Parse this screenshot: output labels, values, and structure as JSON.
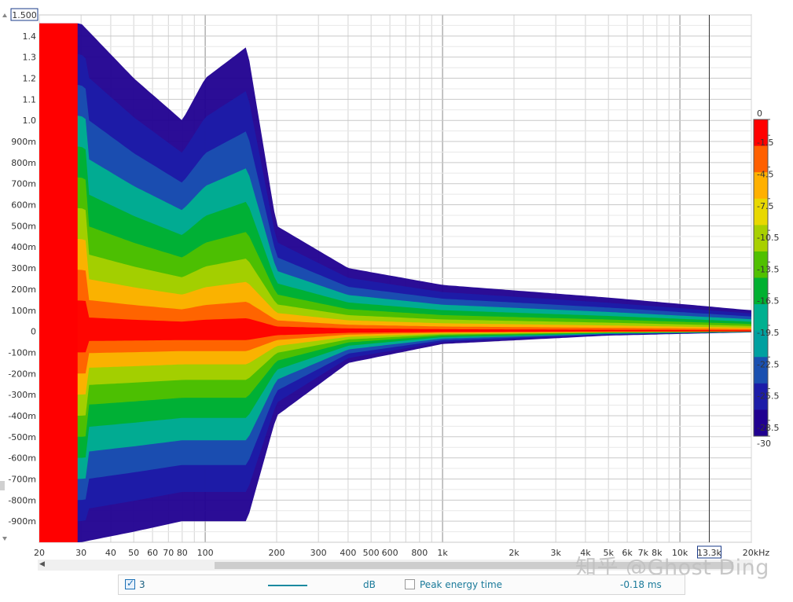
{
  "chart_data": {
    "type": "heatmap",
    "title": "",
    "xlabel": "",
    "ylabel": "",
    "x_scale": "log",
    "xlim": [
      20,
      20000
    ],
    "ylim": [
      -1.0,
      1.5
    ],
    "x_ticks": [
      {
        "v": 20,
        "label": "20"
      },
      {
        "v": 30,
        "label": "30"
      },
      {
        "v": 40,
        "label": "40"
      },
      {
        "v": 50,
        "label": "50"
      },
      {
        "v": 60,
        "label": "60"
      },
      {
        "v": 70,
        "label": "70"
      },
      {
        "v": 80,
        "label": "80"
      },
      {
        "v": 100,
        "label": "100"
      },
      {
        "v": 200,
        "label": "200"
      },
      {
        "v": 300,
        "label": "300"
      },
      {
        "v": 400,
        "label": "400"
      },
      {
        "v": 500,
        "label": "500"
      },
      {
        "v": 600,
        "label": "600"
      },
      {
        "v": 800,
        "label": "800"
      },
      {
        "v": 1000,
        "label": "1k"
      },
      {
        "v": 2000,
        "label": "2k"
      },
      {
        "v": 3000,
        "label": "3k"
      },
      {
        "v": 4000,
        "label": "4k"
      },
      {
        "v": 5000,
        "label": "5k"
      },
      {
        "v": 6000,
        "label": "6k"
      },
      {
        "v": 7000,
        "label": "7k"
      },
      {
        "v": 8000,
        "label": "8k"
      },
      {
        "v": 10000,
        "label": "10k"
      },
      {
        "v": 20000,
        "label": "20kHz"
      }
    ],
    "y_ticks": [
      {
        "v": 1.4,
        "label": "1.4"
      },
      {
        "v": 1.3,
        "label": "1.3"
      },
      {
        "v": 1.2,
        "label": "1.2"
      },
      {
        "v": 1.1,
        "label": "1.1"
      },
      {
        "v": 1.0,
        "label": "1.0"
      },
      {
        "v": 0.9,
        "label": "900m"
      },
      {
        "v": 0.8,
        "label": "800m"
      },
      {
        "v": 0.7,
        "label": "700m"
      },
      {
        "v": 0.6,
        "label": "600m"
      },
      {
        "v": 0.5,
        "label": "500m"
      },
      {
        "v": 0.4,
        "label": "400m"
      },
      {
        "v": 0.3,
        "label": "300m"
      },
      {
        "v": 0.2,
        "label": "200m"
      },
      {
        "v": 0.1,
        "label": "100m"
      },
      {
        "v": 0,
        "label": "0"
      },
      {
        "v": -0.1,
        "label": "-100m"
      },
      {
        "v": -0.2,
        "label": "-200m"
      },
      {
        "v": -0.3,
        "label": "-300m"
      },
      {
        "v": -0.4,
        "label": "-400m"
      },
      {
        "v": -0.5,
        "label": "-500m"
      },
      {
        "v": -0.6,
        "label": "-600m"
      },
      {
        "v": -0.7,
        "label": "-700m"
      },
      {
        "v": -0.8,
        "label": "-800m"
      },
      {
        "v": -0.9,
        "label": "-900m"
      }
    ],
    "y_top_readout": "1.500",
    "x_cursor": {
      "value": 13300,
      "label": "13.3k"
    },
    "grid": true,
    "colorbar": {
      "range": [
        -30,
        0
      ],
      "ticks": [
        "0",
        "-1.5",
        "-4.5",
        "-7.5",
        "-10.5",
        "-13.5",
        "-16.5",
        "-19.5",
        "-22.5",
        "-25.5",
        "-28.5",
        "-30"
      ],
      "colors": [
        "#ff0000",
        "#ff6000",
        "#ffb000",
        "#e8d800",
        "#a8d000",
        "#50c000",
        "#00b030",
        "#00b090",
        "#00a0a0",
        "#1a50b0",
        "#1c1ca8",
        "#200090"
      ],
      "placement": "right"
    },
    "envelope": [
      {
        "f": 20,
        "top": 1.46,
        "bottom": -1.0
      },
      {
        "f": 30,
        "top": 1.46,
        "bottom": -1.0
      },
      {
        "f": 50,
        "top": 1.2,
        "bottom": -0.95
      },
      {
        "f": 80,
        "top": 1.0,
        "bottom": -0.9
      },
      {
        "f": 100,
        "top": 1.2,
        "bottom": -0.9
      },
      {
        "f": 150,
        "top": 1.35,
        "bottom": -0.9
      },
      {
        "f": 200,
        "top": 0.5,
        "bottom": -0.4
      },
      {
        "f": 400,
        "top": 0.3,
        "bottom": -0.15
      },
      {
        "f": 1000,
        "top": 0.22,
        "bottom": -0.06
      },
      {
        "f": 5000,
        "top": 0.16,
        "bottom": -0.02
      },
      {
        "f": 20000,
        "top": 0.1,
        "bottom": -0.005
      }
    ]
  },
  "legend": {
    "trace_name": "3",
    "trace_checked": true,
    "unit": "dB",
    "peak_label": "Peak energy time",
    "peak_checked": false,
    "peak_value": "-0.18 ms",
    "trace_color": "#1b8aa0"
  },
  "watermark": "知乎 @Ghost Ding"
}
